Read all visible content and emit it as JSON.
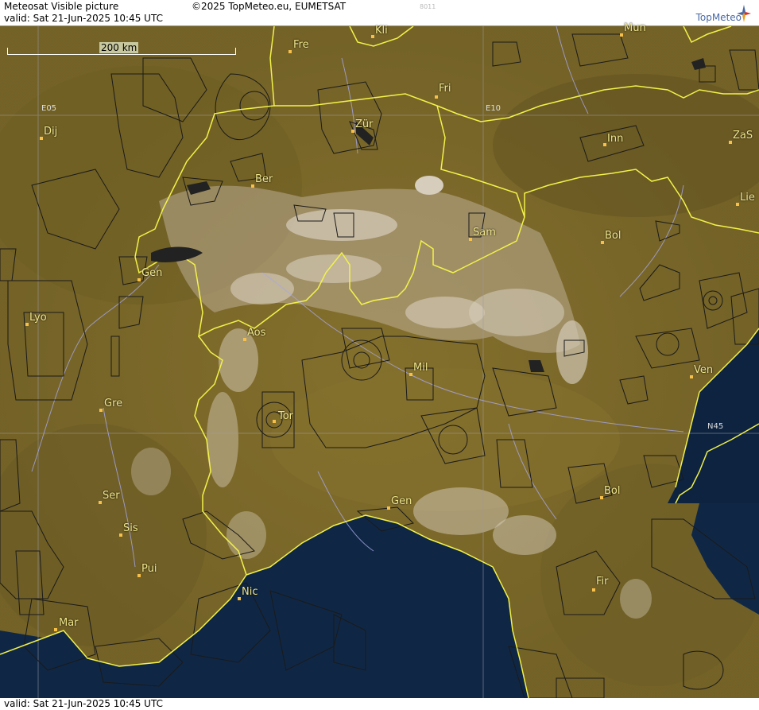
{
  "header": {
    "title": "Meteosat Visible picture",
    "valid": "valid:  Sat  21-Jun-2025  10:45 UTC",
    "copyright": "©2025 TopMeteo.eu, EUMETSAT",
    "code": "8011",
    "logo_text": "TopMeteo"
  },
  "footer": {
    "valid": "valid:  Sat  21-Jun-2025  10:45 UTC"
  },
  "scale": {
    "label": "200 km"
  },
  "grid_labels": [
    "E05",
    "E10",
    "N45"
  ],
  "cities": [
    "Kli",
    "Mun",
    "Fre",
    "Fri",
    "Zür",
    "Inn",
    "ZaS",
    "Dij",
    "Ber",
    "Lie",
    "Sam",
    "Bol",
    "Gen",
    "Lyo",
    "Aos",
    "Mil",
    "Ven",
    "Gre",
    "Tor",
    "Ser",
    "Gen",
    "Bol",
    "Sis",
    "Pui",
    "Nic",
    "Fir",
    "Mar"
  ],
  "colors": {
    "land": "#7d6a2a",
    "land_dark": "#5c4f1e",
    "sea": "#0f2745",
    "border": "#f2f24a",
    "airspace": "#1a1a1a",
    "river": "#a8a8e8",
    "snow": "#e8e0d8",
    "label": "#f0e68c"
  }
}
